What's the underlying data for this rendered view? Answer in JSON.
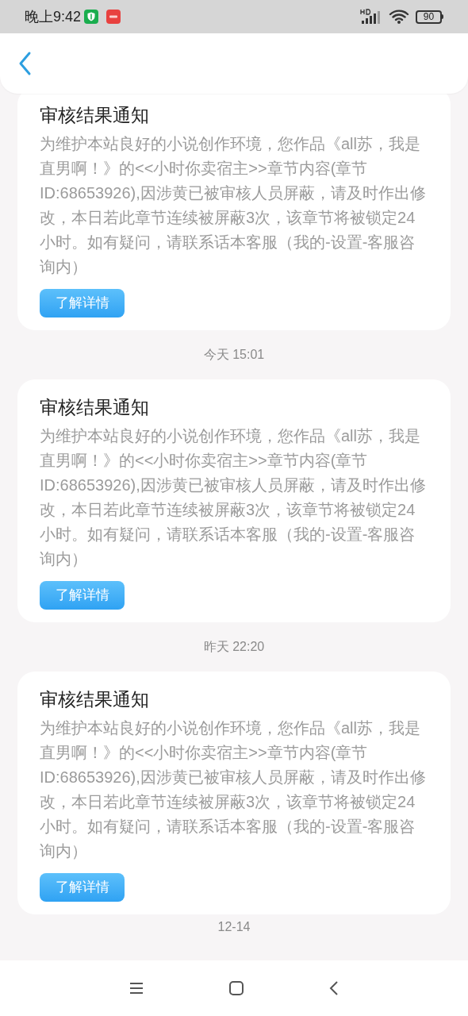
{
  "status_bar": {
    "time": "晚上9:42",
    "battery": "90"
  },
  "messages": [
    {
      "title": "审核结果通知",
      "body": "为维护本站良好的小说创作环境，您作品《all苏，我是直男啊！》的<<小时你卖宿主>>章节内容(章节ID:68653926),因涉黄已被审核人员屏蔽，请及时作出修改，本日若此章节连续被屏蔽3次，该章节将被锁定24小时。如有疑问，请联系话本客服（我的-设置-客服咨询内）",
      "button": "了解详情"
    },
    {
      "timestamp": "今天 15:01",
      "title": "审核结果通知",
      "body": "为维护本站良好的小说创作环境，您作品《all苏，我是直男啊！》的<<小时你卖宿主>>章节内容(章节ID:68653926),因涉黄已被审核人员屏蔽，请及时作出修改，本日若此章节连续被屏蔽3次，该章节将被锁定24小时。如有疑问，请联系话本客服（我的-设置-客服咨询内）",
      "button": "了解详情"
    },
    {
      "timestamp": "昨天 22:20",
      "title": "审核结果通知",
      "body": "为维护本站良好的小说创作环境，您作品《all苏，我是直男啊！》的<<小时你卖宿主>>章节内容(章节ID:68653926),因涉黄已被审核人员屏蔽，请及时作出修改，本日若此章节连续被屏蔽3次，该章节将被锁定24小时。如有疑问，请联系话本客服（我的-设置-客服咨询内）",
      "button": "了解详情"
    },
    {
      "timestamp": "12-14"
    }
  ]
}
